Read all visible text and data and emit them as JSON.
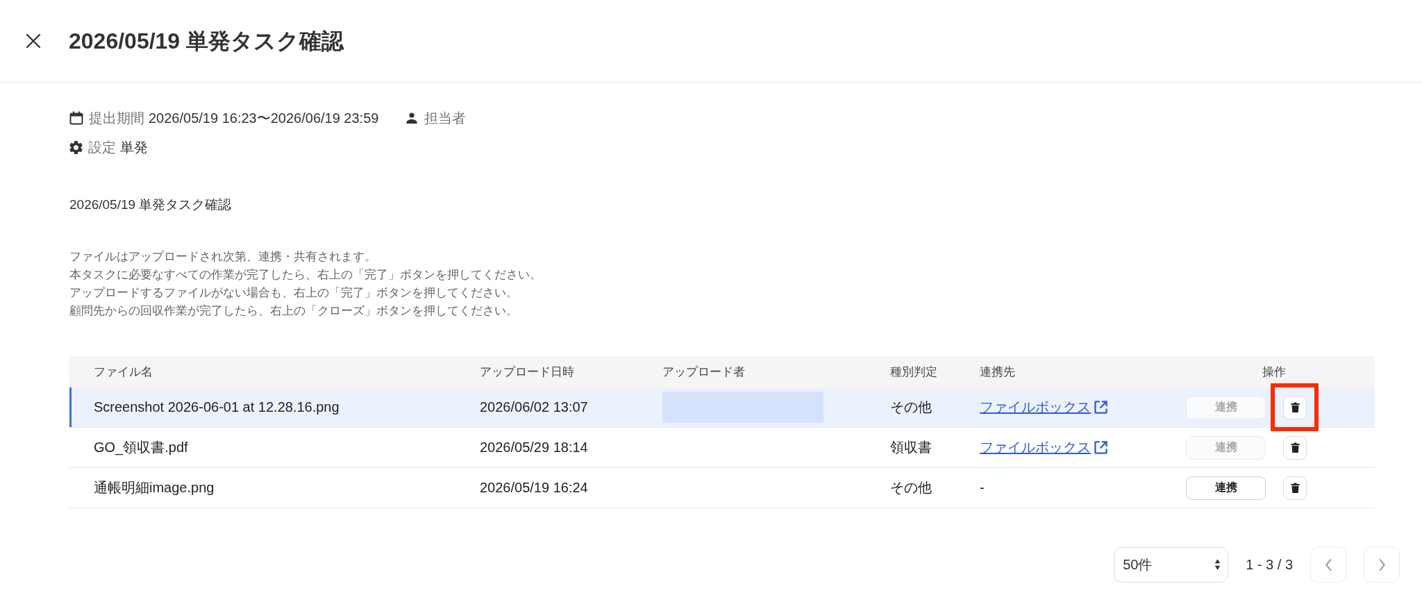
{
  "header": {
    "title": "2026/05/19 単発タスク確認"
  },
  "meta_rows": [
    [
      {
        "kind": "period",
        "label": "提出期間",
        "value": "2026/05/19 16:23〜2026/06/19 23:59"
      },
      {
        "kind": "assignee",
        "label": "担当者"
      }
    ],
    [
      {
        "kind": "setting",
        "label": "設定",
        "value": "単発"
      }
    ]
  ],
  "description": {
    "title": "2026/05/19 単発タスク確認",
    "lines": [
      "ファイルはアップロードされ次第、連携・共有されます。",
      "本タスクに必要なすべての作業が完了したら、右上の「完了」ボタンを押してください。",
      "アップロードするファイルがない場合も、右上の「完了」ボタンを押してください。",
      "顧問先からの回収作業が完了したら、右上の「クローズ」ボタンを押してください。"
    ]
  },
  "table": {
    "columns": [
      "ファイル名",
      "アップロード日時",
      "アップロード者",
      "種別判定",
      "連携先",
      "操作"
    ],
    "rows": [
      {
        "selected": true,
        "file_name": "Screenshot 2026-06-01 at 12.28.16.png",
        "uploaded_at": "2026/06/02 13:07",
        "uploader_redacted": true,
        "category": "その他",
        "destination": {
          "kind": "link",
          "text": "ファイルボックス"
        },
        "link_button": {
          "label": "連携",
          "disabled": true
        },
        "delete_highlighted": true
      },
      {
        "selected": false,
        "file_name": "GO_領収書.pdf",
        "uploaded_at": "2026/05/29 18:14",
        "uploader_redacted": false,
        "category": "領収書",
        "destination": {
          "kind": "link",
          "text": "ファイルボックス"
        },
        "link_button": {
          "label": "連携",
          "disabled": true
        },
        "delete_highlighted": false
      },
      {
        "selected": false,
        "file_name": "通帳明細image.png",
        "uploaded_at": "2026/05/19 16:24",
        "uploader_redacted": false,
        "category": "その他",
        "destination": {
          "kind": "text",
          "text": "-"
        },
        "link_button": {
          "label": "連携",
          "disabled": false
        },
        "delete_highlighted": false
      }
    ]
  },
  "pagination": {
    "page_size": "50件",
    "range": "1 - 3 / 3",
    "prev": {
      "disabled": true
    },
    "next": {
      "disabled": true
    }
  }
}
